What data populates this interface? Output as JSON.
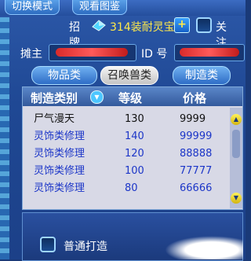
{
  "tabs": [
    "切换模式",
    "观看图鉴"
  ],
  "header": {
    "signboard_label": "招牌",
    "signboard_text": "314装耐灵宝",
    "plus_label": "+",
    "follow_label": "关注"
  },
  "stall": {
    "owner_label": "摊主",
    "id_label": "ID 号"
  },
  "categories": [
    "物品类",
    "召唤兽类",
    "制造类"
  ],
  "table": {
    "columns": [
      "制造类别",
      "等级",
      "价格"
    ],
    "rows": [
      {
        "name": "尸气漫天",
        "level": "130",
        "price": "9999"
      },
      {
        "name": "灵饰类修理",
        "level": "140",
        "price": "99999"
      },
      {
        "name": "灵饰类修理",
        "level": "120",
        "price": "88888"
      },
      {
        "name": "灵饰类修理",
        "level": "100",
        "price": "77777"
      },
      {
        "name": "灵饰类修理",
        "level": "80",
        "price": "66666"
      }
    ]
  },
  "footer": {
    "normal_craft_label": "普通打造"
  },
  "icons": {
    "sort": "chevron-down-icon",
    "scroll_up": "triangle-up-icon",
    "scroll_down": "triangle-down-icon",
    "gem": "gem-icon"
  },
  "colors": {
    "signboard_text": "#ffe94a",
    "row_text_blue": "#1c36c8",
    "redaction": "#d82a2a"
  }
}
